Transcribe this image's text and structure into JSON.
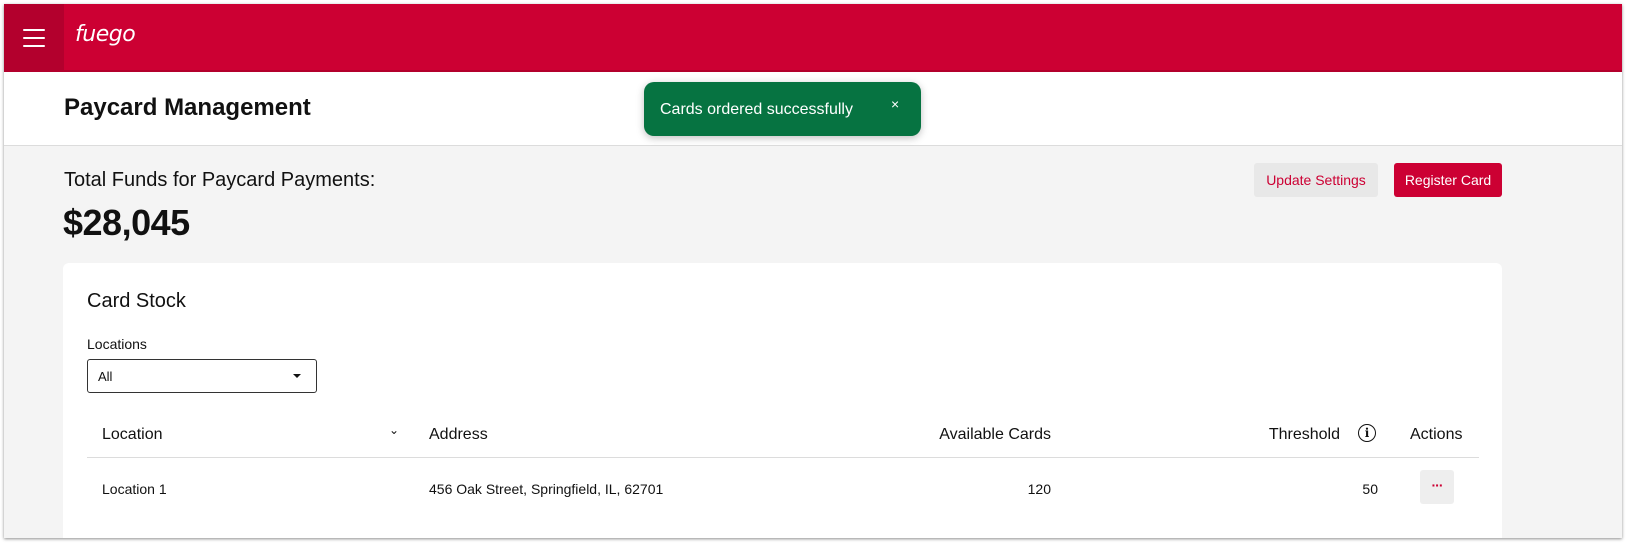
{
  "app": {
    "logo_text": "fuego",
    "brand_color": "#cc0033",
    "success_color": "#067341"
  },
  "header": {
    "title": "Paycard Management"
  },
  "toast": {
    "message": "Cards ordered successfully",
    "close_glyph": "×"
  },
  "funds": {
    "label": "Total Funds for Paycard Payments:",
    "value": "$28,045"
  },
  "actions": {
    "update_settings": "Update Settings",
    "register_card": "Register Card"
  },
  "card_stock": {
    "title": "Card Stock",
    "filter": {
      "label": "Locations",
      "value": "All"
    },
    "columns": {
      "location": "Location",
      "address": "Address",
      "available": "Available Cards",
      "threshold": "Threshold",
      "actions": "Actions"
    },
    "rows": [
      {
        "location": "Location 1",
        "address": "456 Oak Street, Springfield, IL, 62701",
        "available": "120",
        "threshold": "50",
        "actions_glyph": "···"
      }
    ]
  },
  "icons": [
    "menu-icon",
    "close-icon",
    "chevron-down-icon",
    "caret-down-icon",
    "info-icon",
    "more-icon"
  ]
}
